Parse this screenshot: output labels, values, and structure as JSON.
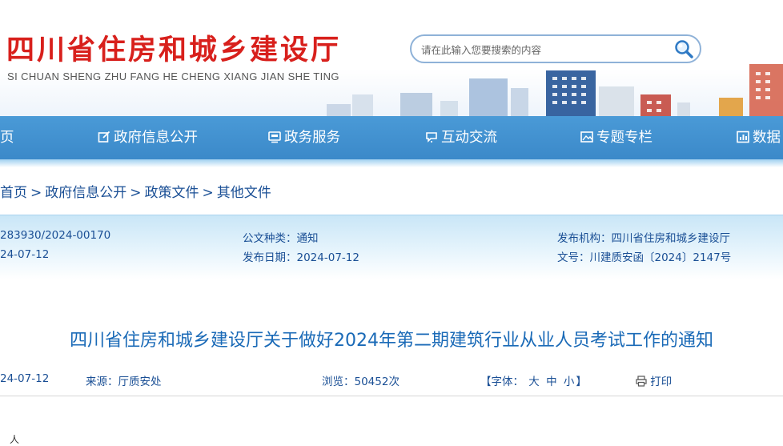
{
  "header": {
    "site_title": "四川省住房和城乡建设厅",
    "site_pinyin": "SI CHUAN SHENG ZHU FANG HE CHENG XIANG JIAN SHE TING",
    "search_placeholder": "请在此输入您要搜索的内容"
  },
  "nav": {
    "items": [
      {
        "label": "页",
        "icon": "home-icon"
      },
      {
        "label": "政府信息公开",
        "icon": "edit-icon"
      },
      {
        "label": "政务服务",
        "icon": "monitor-icon"
      },
      {
        "label": "互动交流",
        "icon": "chat-icon"
      },
      {
        "label": "专题专栏",
        "icon": "image-icon"
      },
      {
        "label": "数据",
        "icon": "chart-icon"
      }
    ]
  },
  "breadcrumb": [
    "首页",
    "政府信息公开",
    "政策文件",
    "其他文件"
  ],
  "breadcrumb_separator": ">",
  "meta": {
    "index_no": "283930/2024-00170",
    "gen_date": "24-07-12",
    "doc_type_label": "公文种类：",
    "doc_type": "通知",
    "pub_date_label": "发布日期：",
    "pub_date": "2024-07-12",
    "org_label": "发布机构：",
    "org": "四川省住房和城乡建设厅",
    "doc_no_label": "文号：",
    "doc_no": "川建质安函〔2024〕2147号"
  },
  "article": {
    "title": "四川省住房和城乡建设厅关于做好2024年第二期建筑行业从业人员考试工作的通知",
    "date": "24-07-12",
    "source_label": "来源：",
    "source": "厅质安处",
    "views_label": "浏览：",
    "views": "50452次",
    "font_label": "【字体：",
    "font_large": "大",
    "font_medium": "中",
    "font_small": "小",
    "font_end": "】",
    "print_label": "打印",
    "body_start": "人"
  },
  "colors": {
    "title_red": "#d8201c",
    "nav_blue": "#3b89c9",
    "link_blue": "#1a4f95",
    "article_title_blue": "#1a6ab7"
  }
}
